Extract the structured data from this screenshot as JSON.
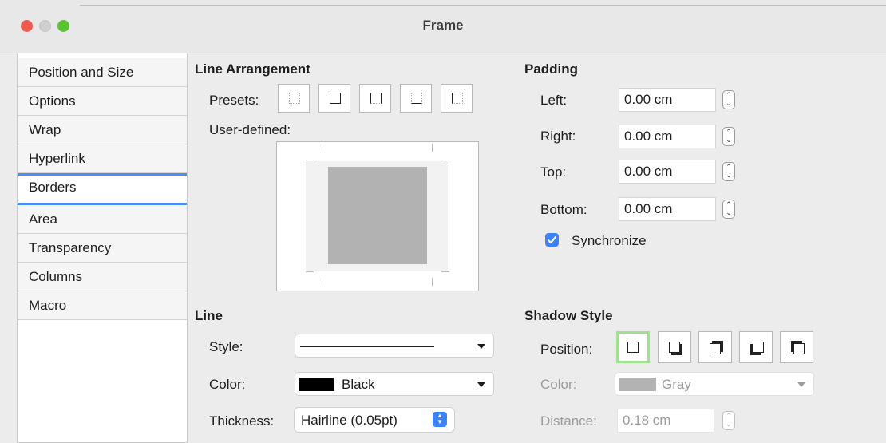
{
  "window": {
    "title": "Frame"
  },
  "sidebar": {
    "items": [
      {
        "label": "Position and Size"
      },
      {
        "label": "Options"
      },
      {
        "label": "Wrap"
      },
      {
        "label": "Hyperlink"
      },
      {
        "label": "Borders"
      },
      {
        "label": "Area"
      },
      {
        "label": "Transparency"
      },
      {
        "label": "Columns"
      },
      {
        "label": "Macro"
      }
    ],
    "selected": "Borders"
  },
  "line_arrangement": {
    "title": "Line Arrangement",
    "presets_label": "Presets:",
    "user_defined_label": "User-defined:"
  },
  "padding": {
    "title": "Padding",
    "left_label": "Left:",
    "left_value": "0.00 cm",
    "right_label": "Right:",
    "right_value": "0.00 cm",
    "top_label": "Top:",
    "top_value": "0.00 cm",
    "bottom_label": "Bottom:",
    "bottom_value": "0.00 cm",
    "synchronize_label": "Synchronize",
    "synchronize_checked": true
  },
  "line": {
    "title": "Line",
    "style_label": "Style:",
    "color_label": "Color:",
    "color_value": "Black",
    "color_swatch": "#000000",
    "thickness_label": "Thickness:",
    "thickness_value": "Hairline (0.05pt)"
  },
  "shadow_style": {
    "title": "Shadow Style",
    "position_label": "Position:",
    "color_label": "Color:",
    "color_value": "Gray",
    "color_swatch": "#b3b3b3",
    "distance_label": "Distance:",
    "distance_value": "0.18 cm"
  },
  "colors": {
    "accent": "#4a8ef5",
    "selected_shadow": "#9be38c"
  }
}
